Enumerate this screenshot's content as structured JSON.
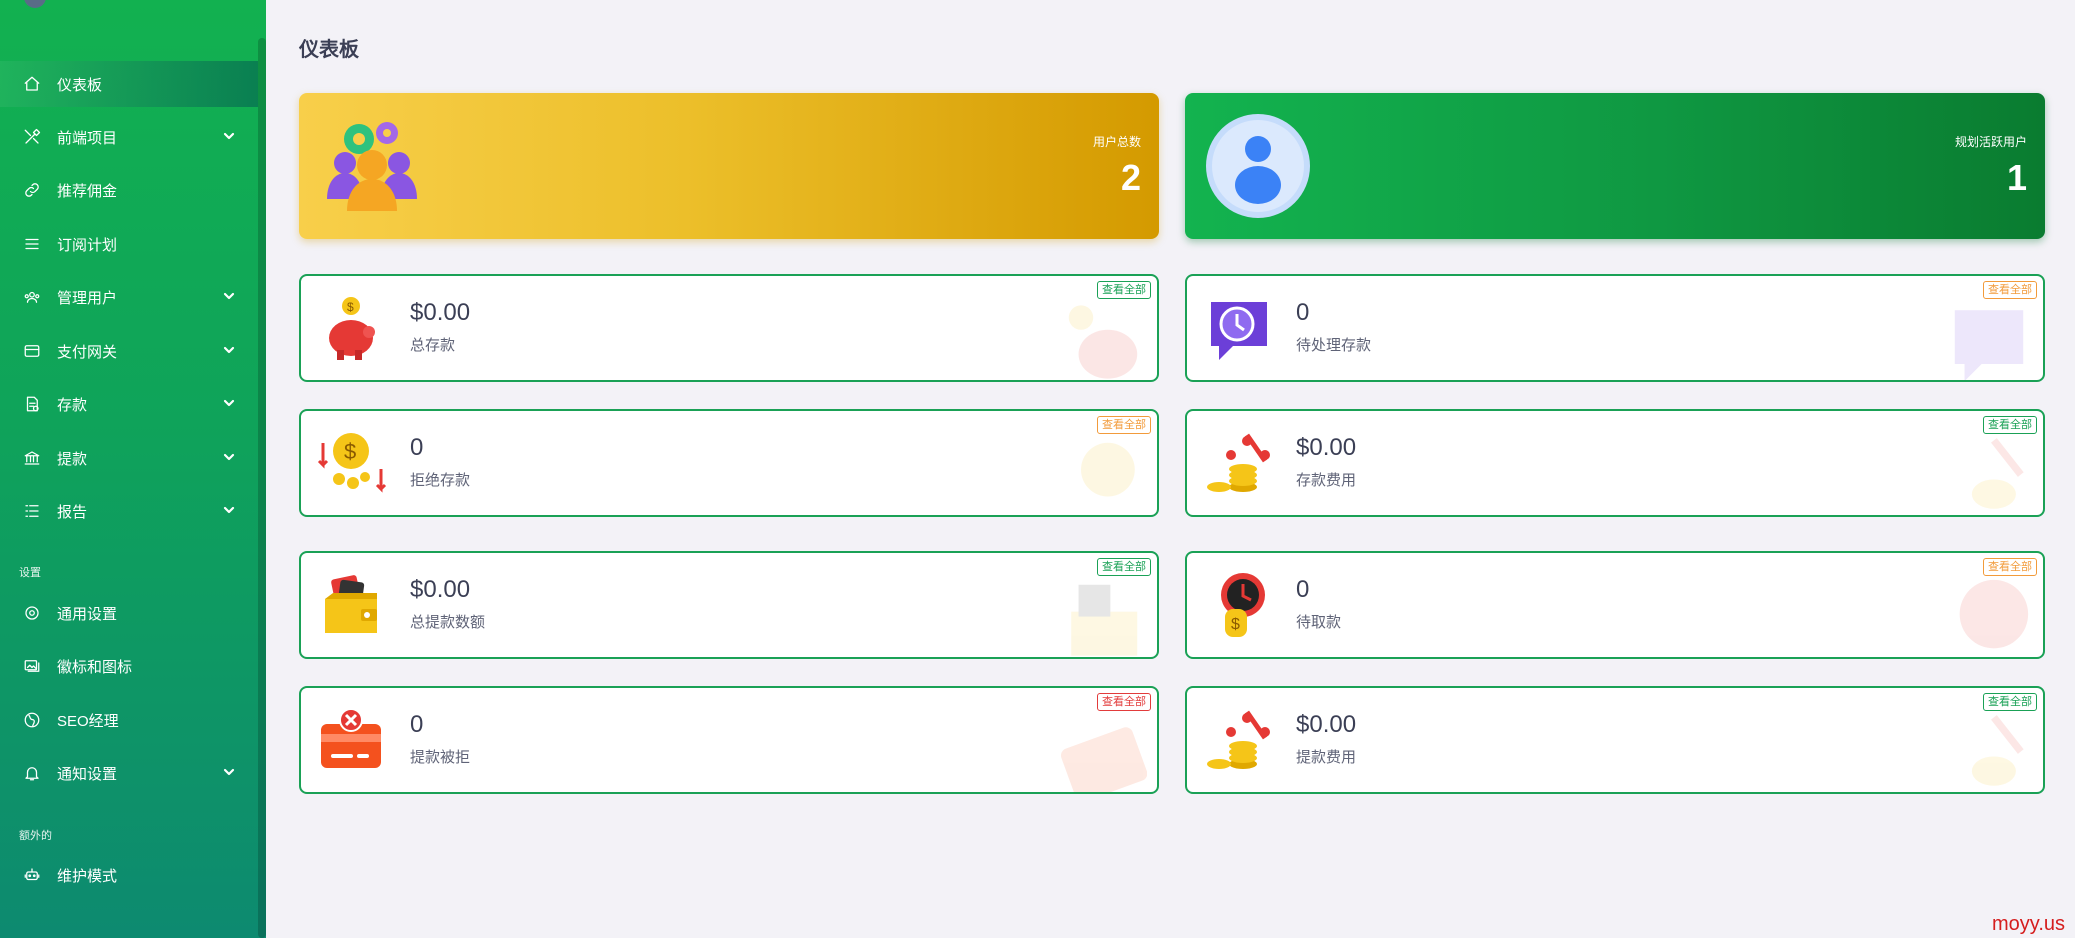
{
  "sidebar": {
    "items": [
      {
        "label": "仪表板",
        "icon": "home-icon",
        "active": true
      },
      {
        "label": "前端项目",
        "icon": "tools-icon",
        "expandable": true
      },
      {
        "label": "推荐佣金",
        "icon": "link-icon"
      },
      {
        "label": "订阅计划",
        "icon": "list-icon"
      },
      {
        "label": "管理用户",
        "icon": "users-icon",
        "expandable": true
      },
      {
        "label": "支付网关",
        "icon": "credit-card-icon",
        "expandable": true
      },
      {
        "label": "存款",
        "icon": "deposit-icon",
        "expandable": true
      },
      {
        "label": "提款",
        "icon": "bank-icon",
        "expandable": true
      },
      {
        "label": "报告",
        "icon": "report-list-icon",
        "expandable": true
      }
    ],
    "settings_heading": "设置",
    "settings_items": [
      {
        "label": "通用设置",
        "icon": "settings-circle-icon"
      },
      {
        "label": "徽标和图标",
        "icon": "images-icon"
      },
      {
        "label": "SEO经理",
        "icon": "globe-icon"
      },
      {
        "label": "通知设置",
        "icon": "bell-icon",
        "expandable": true
      }
    ],
    "extra_heading": "额外的",
    "extra_items": [
      {
        "label": "维护模式",
        "icon": "robot-icon"
      }
    ]
  },
  "page": {
    "title": "仪表板"
  },
  "hero_cards": [
    {
      "label": "用户总数",
      "value": "2",
      "icon": "users-gear-illustration-icon"
    },
    {
      "label": "规划活跃用户",
      "value": "1",
      "icon": "user-avatar-illustration-icon"
    }
  ],
  "stat_cards": [
    {
      "value": "$0.00",
      "label": "总存款",
      "view_all": "查看全部",
      "icon": "piggy-bank-icon",
      "badge_color": "#1aa156"
    },
    {
      "value": "0",
      "label": "待处理存款",
      "view_all": "查看全部",
      "icon": "clock-chat-icon",
      "badge_color": "#f29b3b"
    },
    {
      "value": "0",
      "label": "拒绝存款",
      "view_all": "查看全部",
      "icon": "coin-down-icon",
      "badge_color": "#f29b3b"
    },
    {
      "value": "$0.00",
      "label": "存款费用",
      "view_all": "查看全部",
      "icon": "coins-percent-icon",
      "badge_color": "#1aa156"
    },
    {
      "value": "$0.00",
      "label": "总提款数额",
      "view_all": "查看全部",
      "icon": "wallet-icon",
      "badge_color": "#1aa156"
    },
    {
      "value": "0",
      "label": "待取款",
      "view_all": "查看全部",
      "icon": "clock-coin-icon",
      "badge_color": "#f29b3b"
    },
    {
      "value": "0",
      "label": "提款被拒",
      "view_all": "查看全部",
      "icon": "card-rejected-icon",
      "badge_color": "#e23b3b"
    },
    {
      "value": "$0.00",
      "label": "提款费用",
      "view_all": "查看全部",
      "icon": "coins-percent-icon",
      "badge_color": "#1aa156"
    }
  ],
  "watermark": "moyy.us"
}
